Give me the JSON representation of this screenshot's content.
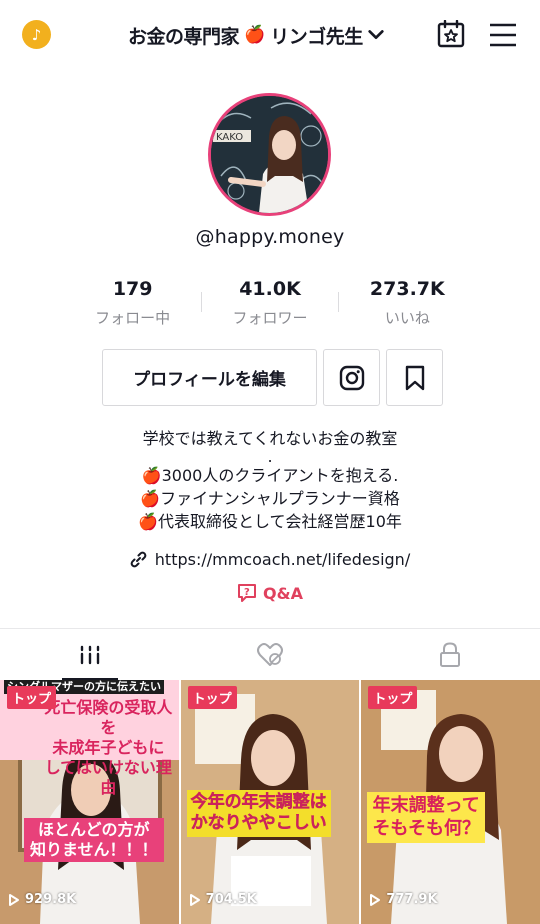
{
  "header": {
    "account_name": "お金の専門家",
    "account_emoji": "🍎",
    "account_name_suffix": "リンゴ先生",
    "icons": [
      "tiktok-coin-icon",
      "chevron-down-icon",
      "calendar-star-icon",
      "menu-icon"
    ]
  },
  "profile": {
    "handle": "@happy.money",
    "stats": [
      {
        "value": "179",
        "label": "フォロー中"
      },
      {
        "value": "41.0K",
        "label": "フォロワー"
      },
      {
        "value": "273.7K",
        "label": "いいね"
      }
    ],
    "edit_button": "プロフィールを編集",
    "bio_line1": "学校では教えてくれないお金の教室",
    "bio_dot": ".",
    "bio_items": [
      "3000人のクライアントを抱える.",
      "ファイナンシャルプランナー資格",
      "代表取締役として会社経営歴10年"
    ],
    "bio_emoji": "🍎",
    "link": "https://mmcoach.net/lifedesign/",
    "qa_label": "Q&A"
  },
  "tabs": [
    "videos-tab",
    "liked-tab",
    "private-tab"
  ],
  "videos": [
    {
      "badge": "トップ",
      "views": "929.8K",
      "caption_top": "シングルマザーの方に伝えたい",
      "caption_lines": [
        "死亡保険の受取人を",
        "未成年子どもに",
        "してはいけない理由"
      ],
      "caption_bottom": [
        "ほとんどの方が",
        "知りません！！！"
      ]
    },
    {
      "badge": "トップ",
      "views": "704.5K",
      "caption_lines": [
        "今年の年末調整は",
        "かなりややこしい"
      ]
    },
    {
      "badge": "トップ",
      "views": "777.9K",
      "caption_lines": [
        "年末調整って",
        "そもそも何？"
      ]
    }
  ],
  "colors": {
    "accent": "#e0415e",
    "badge": "#e83a5b",
    "coin": "#f2b01e",
    "avatar_ring": "#e8417a"
  }
}
